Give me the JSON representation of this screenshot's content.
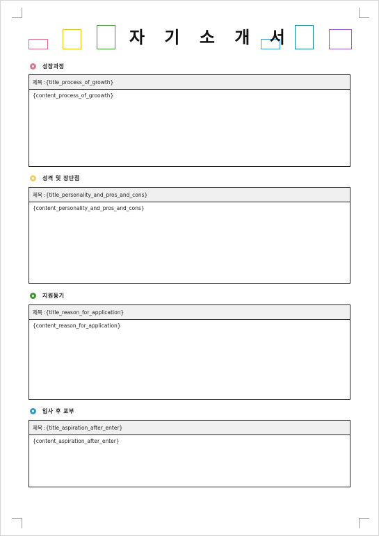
{
  "document": {
    "title": "자 기 소 개 서",
    "title_prefix": "제목 : ",
    "decor_colors": [
      "#e06f8b",
      "#f0c419",
      "#3c9a2f",
      "#3ca0d0",
      "#1a8aa0",
      "#a05ad0"
    ]
  },
  "sections": [
    {
      "heading": "성장과정",
      "bullet_color": "#e0748c",
      "title_placeholder": "{title_process_of_growth}",
      "content_placeholder": "{content_process_of_groowth}"
    },
    {
      "heading": "성격 및 장단점",
      "bullet_color": "#f0cf6a",
      "title_placeholder": "{title_personality_and_pros_and_cons}",
      "content_placeholder": "{content_personality_and_pros_and_cons}"
    },
    {
      "heading": "지원동기",
      "bullet_color": "#3c9a2f",
      "title_placeholder": "{title_reason_for_application}",
      "content_placeholder": "{content_reason_for_application}"
    },
    {
      "heading": "입사 후 포부",
      "bullet_color": "#2f9ad8",
      "title_placeholder": "{title_aspiration_after_enter}",
      "content_placeholder": "{content_aspiration_after_enter}"
    }
  ]
}
